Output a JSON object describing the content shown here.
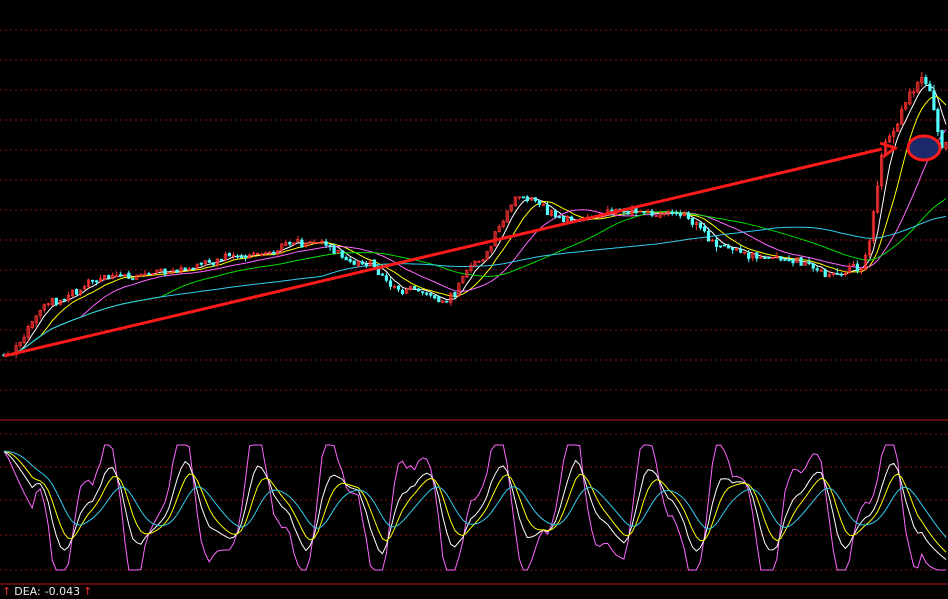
{
  "status": {
    "label": "DEA:",
    "value": "-0.043"
  },
  "icons": {
    "up": "up-arrow-icon"
  },
  "colors": {
    "background": "#000000",
    "grid": "#8a1010",
    "up_candle": "#ff3232",
    "down_candle": "#54ffff",
    "ma_white": "#ffffff",
    "ma_yellow": "#ffff00",
    "ma_magenta": "#ff66ff",
    "ma_green": "#00dd00",
    "ma_cyan": "#33ccee",
    "annotation": "#ff1a1a",
    "highlight_fill": "#1a2a6a"
  },
  "chart_data": [
    {
      "type": "candlestick",
      "panel": "price",
      "grid": true,
      "series_count": 5,
      "annotation": "rising-trend-arrow-to-peak-circle",
      "trend_anchor_points": [
        [
          0,
          0.18
        ],
        [
          0.05,
          0.4
        ],
        [
          0.12,
          0.5
        ],
        [
          0.18,
          0.52
        ],
        [
          0.25,
          0.58
        ],
        [
          0.33,
          0.64
        ],
        [
          0.38,
          0.55
        ],
        [
          0.42,
          0.45
        ],
        [
          0.47,
          0.4
        ],
        [
          0.5,
          0.56
        ],
        [
          0.55,
          0.82
        ],
        [
          0.6,
          0.72
        ],
        [
          0.66,
          0.76
        ],
        [
          0.72,
          0.75
        ],
        [
          0.76,
          0.62
        ],
        [
          0.8,
          0.58
        ],
        [
          0.84,
          0.56
        ],
        [
          0.88,
          0.5
        ],
        [
          0.91,
          0.54
        ],
        [
          0.94,
          1.08
        ],
        [
          0.975,
          1.3
        ],
        [
          1.0,
          1.02
        ]
      ]
    },
    {
      "type": "line",
      "panel": "oscillator",
      "grid": true,
      "series_count": 4
    }
  ]
}
